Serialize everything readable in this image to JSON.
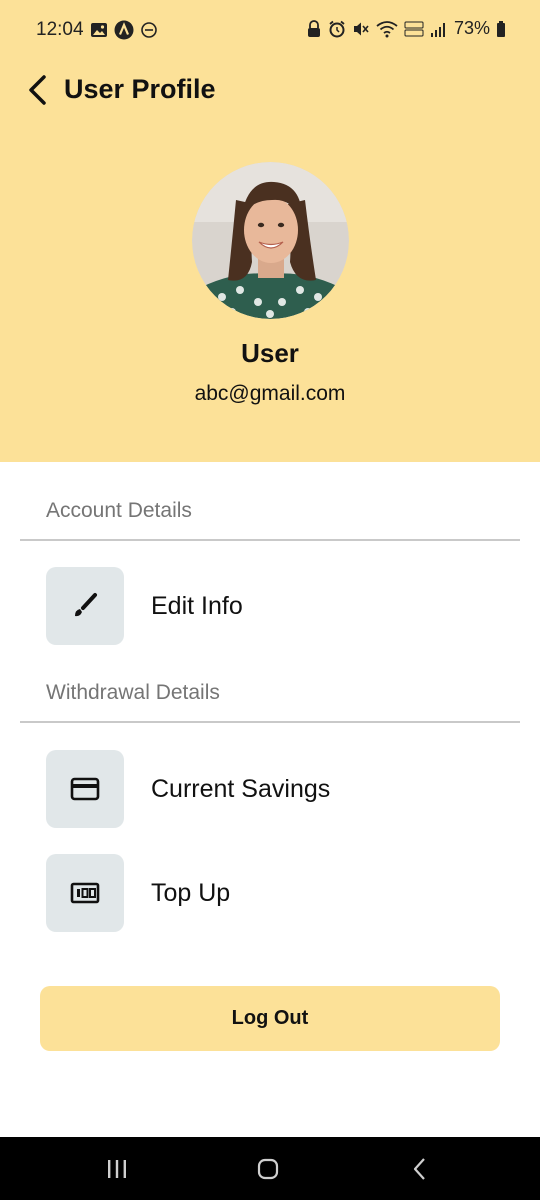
{
  "status_bar": {
    "time": "12:04",
    "battery": "73%",
    "left_icons": [
      "image-icon",
      "app-a-icon",
      "dnd-icon"
    ],
    "right_icons": [
      "lock-icon",
      "alarm-icon",
      "mute-icon",
      "wifi-icon",
      "volte-icon",
      "signal-icon",
      "battery-icon"
    ]
  },
  "header": {
    "title": "User Profile",
    "background_color": "#FCE198"
  },
  "profile": {
    "name": "User",
    "email": "abc@gmail.com"
  },
  "sections": {
    "account": {
      "label": "Account Details",
      "items": [
        {
          "label": "Edit Info",
          "icon": "brush-icon"
        }
      ]
    },
    "withdrawal": {
      "label": "Withdrawal Details",
      "items": [
        {
          "label": "Current Savings",
          "icon": "credit-card-icon"
        },
        {
          "label": "Top Up",
          "icon": "cash-icon"
        }
      ]
    }
  },
  "logout": {
    "label": "Log Out",
    "color": "#FCE198"
  },
  "nav_bar": {
    "icons": [
      "recent-apps-icon",
      "home-icon",
      "back-nav-icon"
    ]
  },
  "colors": {
    "icon_box": "#E1E7E9",
    "section_label": "#757575"
  }
}
